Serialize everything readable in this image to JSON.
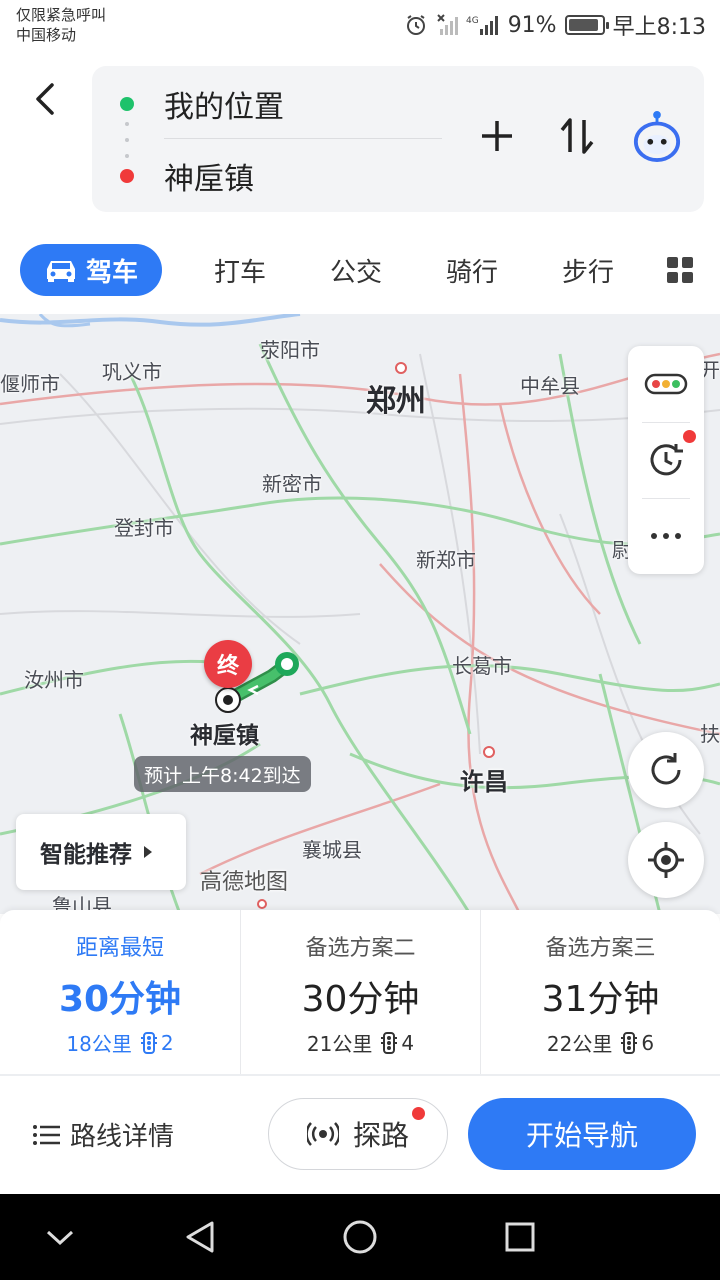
{
  "status_bar": {
    "line1": "仅限紧急呼叫",
    "line2": "中国移动",
    "battery_percent": "91%",
    "battery_level": 0.91,
    "time": "早上8:13",
    "icons": [
      "alarm-icon",
      "sim-off-icon",
      "signal-icon",
      "battery-icon"
    ]
  },
  "route": {
    "from": "我的位置",
    "to": "神垕镇",
    "colors": {
      "origin": "#1ec26b",
      "destination": "#f03a3a"
    }
  },
  "modes": {
    "active": "驾车",
    "items": [
      "打车",
      "公交",
      "骑行",
      "步行"
    ]
  },
  "map": {
    "cities": {
      "zhengzhou": "郑州",
      "xuchang": "许昌",
      "xingyang": "荥阳市",
      "gongyi": "巩义市",
      "yanshi": "偃师市",
      "zhongmou": "中牟县",
      "xinmi": "新密市",
      "dengfeng": "登封市",
      "xinzheng": "新郑市",
      "ruzhou": "汝州市",
      "changge": "长葛市",
      "xiangcheng": "襄城县",
      "lushan": "鲁山县",
      "edge_right_1": "开封",
      "edge_right_2": "尉",
      "edge_right_3": "扶"
    },
    "dest_pin": "终",
    "dest_label": "神垕镇",
    "eta": "预计上午8:42到达",
    "smart_recommend": "智能推荐",
    "watermark": "高德地图"
  },
  "route_options": [
    {
      "name": "距离最短",
      "time": "30分钟",
      "distance": "18公里",
      "lights": "2"
    },
    {
      "name": "备选方案二",
      "time": "30分钟",
      "distance": "21公里",
      "lights": "4"
    },
    {
      "name": "备选方案三",
      "time": "31分钟",
      "distance": "22公里",
      "lights": "6"
    }
  ],
  "actions": {
    "details": "路线详情",
    "explore": "探路",
    "start": "开始导航"
  },
  "theme": {
    "accent": "#2e7af5",
    "alert": "#f03a3a"
  }
}
